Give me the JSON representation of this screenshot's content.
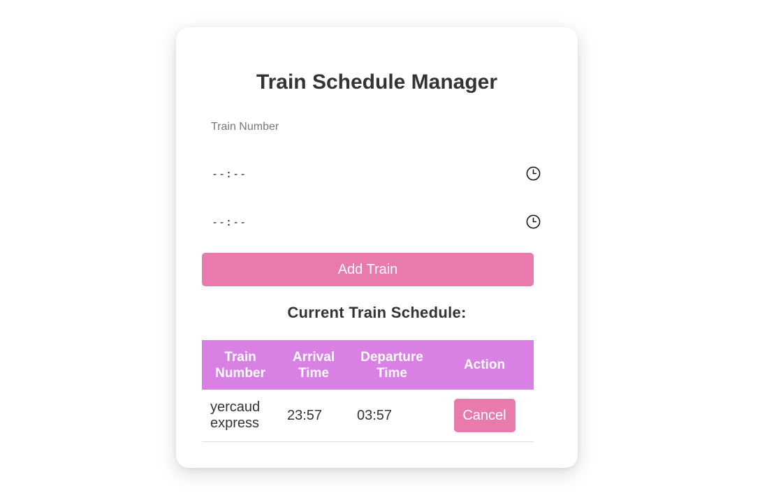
{
  "app": {
    "title": "Train Schedule Manager"
  },
  "form": {
    "train_number_placeholder": "Train Number",
    "train_number_value": "",
    "arrival_time_value": "--:--",
    "departure_time_value": "--:--",
    "arrival_icon": "clock-icon",
    "departure_icon": "clock-icon",
    "add_button_label": "Add Train"
  },
  "schedule": {
    "heading": "Current Train Schedule:",
    "columns": [
      "Train Number",
      "Arrival Time",
      "Departure Time",
      "Action"
    ],
    "rows": [
      {
        "train_number": "yercaud express",
        "arrival_time": "23:57",
        "departure_time": "03:57",
        "action_label": "Cancel"
      }
    ]
  },
  "colors": {
    "accent_button": "#e97aae",
    "table_header": "#d980e5",
    "text": "#333333"
  }
}
